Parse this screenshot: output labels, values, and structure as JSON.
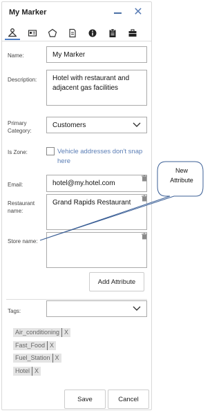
{
  "window": {
    "title": "My Marker"
  },
  "icons": {
    "minimize": "minimize-icon",
    "close": "close-icon",
    "tabs": [
      "location-person-icon",
      "id-card-icon",
      "pentagon-icon",
      "edit-document-icon",
      "info-icon",
      "clipboard-icon",
      "briefcase-icon"
    ]
  },
  "fields": {
    "name": {
      "label": "Name:",
      "value": "My Marker"
    },
    "description": {
      "label": "Description:",
      "value": "Hotel with restaurant and adjacent gas facilities"
    },
    "primary_category": {
      "label": "Primary Category:",
      "value": "Customers"
    },
    "is_zone": {
      "label": "Is Zone:",
      "checked": false,
      "note": "Vehicle addresses don't snap here"
    },
    "email": {
      "label": "Email:",
      "value": "hotel@my.hotel.com"
    },
    "restaurant_name": {
      "label": "Restaurant name:",
      "value": "Grand Rapids Restaurant"
    },
    "store_name": {
      "label": "Store name:",
      "value": ""
    }
  },
  "buttons": {
    "add_attribute": "Add Attribute",
    "save": "Save",
    "cancel": "Cancel"
  },
  "tags": {
    "label": "Tags:",
    "selected": "",
    "items": [
      "Air_conditioning",
      "Fast_Food",
      "Fuel_Station",
      "Hotel"
    ],
    "remove_glyph": "X"
  },
  "callout": {
    "line1": "New",
    "line2": "Attribute"
  },
  "colors": {
    "accent": "#4a7bc4",
    "link": "#5a7db5",
    "tag_bg": "#e4e4e4"
  }
}
